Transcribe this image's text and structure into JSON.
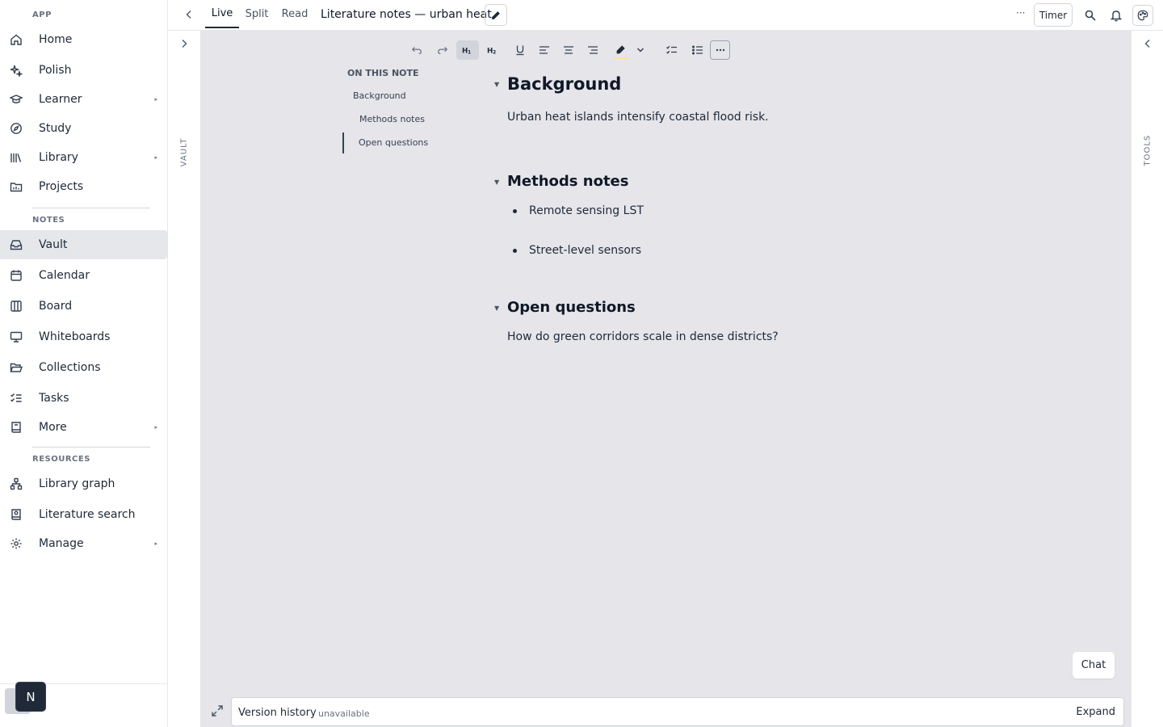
{
  "sidebar": {
    "app_label": "APP",
    "notes_label": "NOTES",
    "resources_label": "RESOURCES",
    "items": [
      {
        "label": "Home",
        "icon": "home-icon",
        "arrow": ""
      },
      {
        "label": "Polish",
        "icon": "sparkles-icon",
        "arrow": ""
      },
      {
        "label": "Learner",
        "icon": "graduation-cap-icon",
        "arrow": "▸"
      },
      {
        "label": "Study",
        "icon": "compass-icon",
        "arrow": ""
      },
      {
        "label": "Library",
        "icon": "library-icon",
        "arrow": "▸"
      },
      {
        "label": "Projects",
        "icon": "folder-chart-icon",
        "arrow": ""
      },
      {
        "label": "Vault",
        "icon": "inbox-icon",
        "arrow": ""
      },
      {
        "label": "Calendar",
        "icon": "calendar-icon",
        "arrow": ""
      },
      {
        "label": "Board",
        "icon": "columns-icon",
        "arrow": ""
      },
      {
        "label": "Whiteboards",
        "icon": "presentation-icon",
        "arrow": ""
      },
      {
        "label": "Collections",
        "icon": "folder-open-icon",
        "arrow": ""
      },
      {
        "label": "Tasks",
        "icon": "list-checks-icon",
        "arrow": ""
      },
      {
        "label": "More",
        "icon": "book-icon",
        "arrow": "▸"
      },
      {
        "label": "Library graph",
        "icon": "network-icon",
        "arrow": ""
      },
      {
        "label": "Literature search",
        "icon": "book-search-icon",
        "arrow": ""
      },
      {
        "label": "Manage",
        "icon": "gear-icon",
        "arrow": "▸"
      }
    ],
    "badge_letter": "N"
  },
  "topbar": {
    "tabs": [
      "Live",
      "Split",
      "Read"
    ],
    "doc_title": "Literature notes — urban heat",
    "dots": "···",
    "timer_label": "Timer"
  },
  "rails": {
    "vault_label": "VAULT",
    "tools_label": "TOOLS"
  },
  "toc": {
    "title": "ON THIS NOTE",
    "items": [
      "Background",
      "Methods notes",
      "Open questions"
    ]
  },
  "content": {
    "sections": [
      {
        "heading": "Background",
        "text": "Urban heat islands intensify coastal flood risk."
      },
      {
        "heading": "Methods notes",
        "bullets": [
          "Remote sensing LST",
          "Street-level sensors"
        ]
      },
      {
        "heading": "Open questions",
        "text": "How do green corridors scale in dense districts?"
      }
    ]
  },
  "chat_label": "Chat",
  "version_history": {
    "label": "Version history",
    "status": "· unavailable",
    "expand_label": "Expand"
  },
  "colors": {
    "canvas_bg": "#e5e5ea",
    "accent_dark": "#1f2937",
    "highlight": "#fde68a"
  }
}
